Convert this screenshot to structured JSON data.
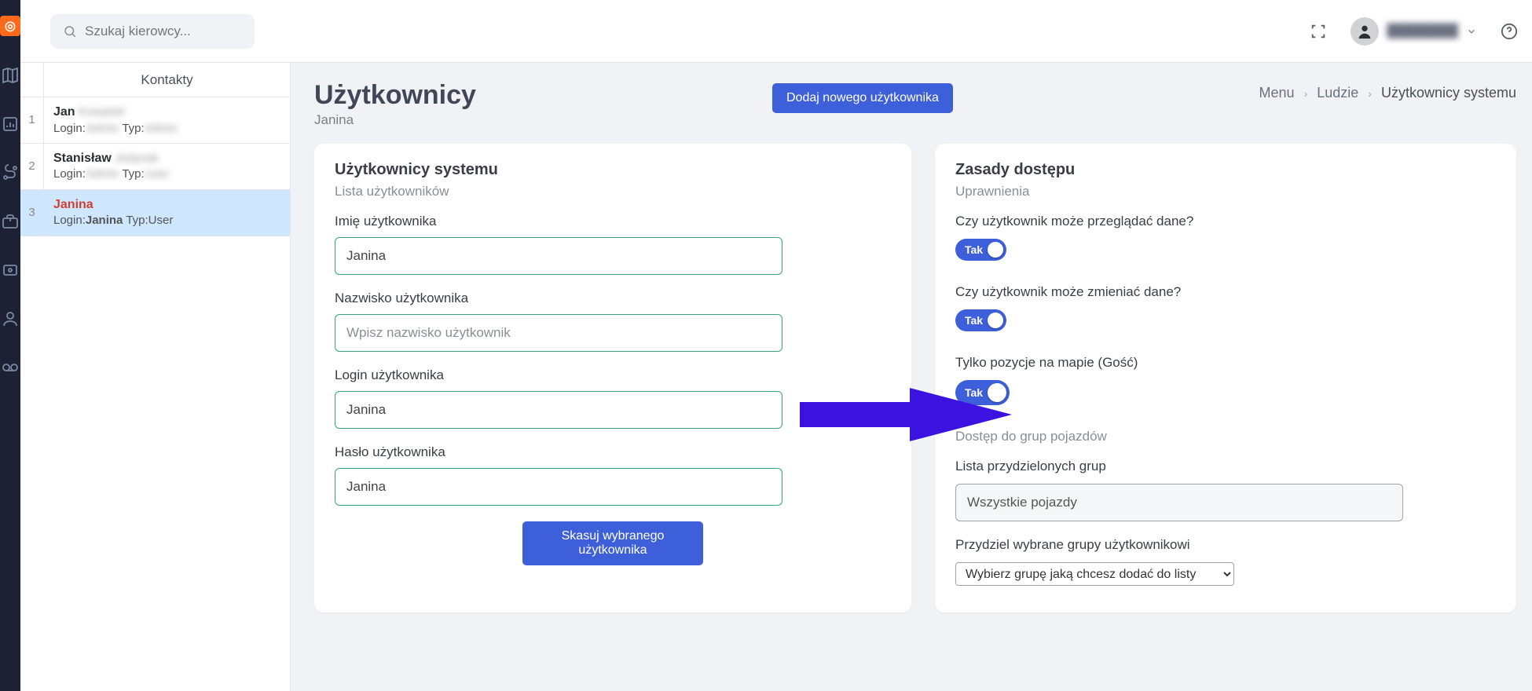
{
  "search": {
    "placeholder": "Szukaj kierowcy..."
  },
  "topbar": {
    "user_name": "████████"
  },
  "contacts": {
    "header": "Kontakty",
    "items": [
      {
        "idx": "1",
        "name": "Jan",
        "surname_blur": "Kowalski",
        "login_label": "Login:",
        "login": "Admin",
        "type_label": "Typ:",
        "type": "Admin"
      },
      {
        "idx": "2",
        "name": "Stanisław",
        "surname_blur": "Jedynak",
        "login_label": "Login:",
        "login": "Admin",
        "type_label": "Typ:",
        "type": "User"
      },
      {
        "idx": "3",
        "name": "Janina",
        "surname_blur": "",
        "login_label": "Login:",
        "login": "Janina",
        "type_label": "Typ:",
        "type": "User"
      }
    ]
  },
  "page": {
    "title": "Użytkownicy",
    "subtitle": "Janina",
    "add_button": "Dodaj nowego użytkownika",
    "breadcrumb": {
      "a": "Menu",
      "b": "Ludzie",
      "c": "Użytkownicy systemu"
    }
  },
  "left_panel": {
    "title": "Użytkownicy systemu",
    "subtitle": "Lista użytkowników",
    "fields": {
      "first_name_label": "Imię użytkownika",
      "first_name_value": "Janina",
      "last_name_label": "Nazwisko użytkownika",
      "last_name_placeholder": "Wpisz nazwisko użytkownik",
      "login_label": "Login użytkownika",
      "login_value": "Janina",
      "password_label": "Hasło użytkownika",
      "password_value": "Janina"
    },
    "delete_button": "Skasuj wybranego użytkownika"
  },
  "right_panel": {
    "title": "Zasady dostępu",
    "subtitle": "Uprawnienia",
    "perms": {
      "view_label": "Czy użytkownik może przeglądać dane?",
      "change_label": "Czy użytkownik może zmieniać dane?",
      "guest_label": "Tylko pozycje na mapie (Gość)",
      "toggle_yes": "Tak"
    },
    "groups_head": "Dostęp do grup pojazdów",
    "groups_list_label": "Lista przydzielonych grup",
    "groups_list_value": "Wszystkie pojazdy",
    "assign_label": "Przydziel wybrane grupy użytkownikowi",
    "assign_select": "Wybierz grupę jaką chcesz dodać do listy"
  }
}
